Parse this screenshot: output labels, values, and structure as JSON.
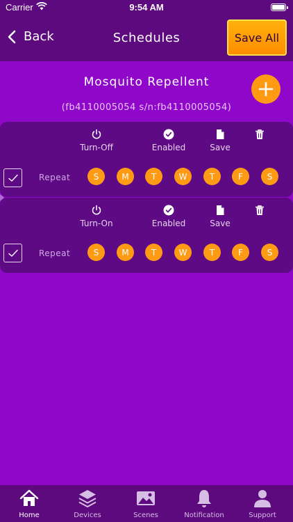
{
  "status_bar": {
    "carrier": "Carrier",
    "time": "9:54 AM"
  },
  "nav": {
    "back_label": "Back",
    "title": "Schedules",
    "save_all_label": "Save All"
  },
  "device": {
    "name": "Mosquito Repellent",
    "serial": "(fb4110005054 s/n:fb4110005054)"
  },
  "schedules": [
    {
      "action_label": "Turn-Off",
      "enabled_label": "Enabled",
      "save_label": "Save",
      "repeat_label": "Repeat",
      "days": [
        "S",
        "M",
        "T",
        "W",
        "T",
        "F",
        "S"
      ],
      "checked": true
    },
    {
      "action_label": "Turn-On",
      "enabled_label": "Enabled",
      "save_label": "Save",
      "repeat_label": "Repeat",
      "days": [
        "S",
        "M",
        "T",
        "W",
        "T",
        "F",
        "S"
      ],
      "checked": true
    }
  ],
  "tabs": [
    {
      "label": "Home",
      "icon": "home-icon",
      "active": true
    },
    {
      "label": "Devices",
      "icon": "layers-icon",
      "active": false
    },
    {
      "label": "Scenes",
      "icon": "image-icon",
      "active": false
    },
    {
      "label": "Notification",
      "icon": "bell-icon",
      "active": false
    },
    {
      "label": "Support",
      "icon": "person-icon",
      "active": false
    }
  ],
  "colors": {
    "background": "#8f07c9",
    "bar": "#5e0a7f",
    "card": "#5f0a85",
    "accent": "#ff9a14",
    "save_border": "#ffe24a"
  }
}
